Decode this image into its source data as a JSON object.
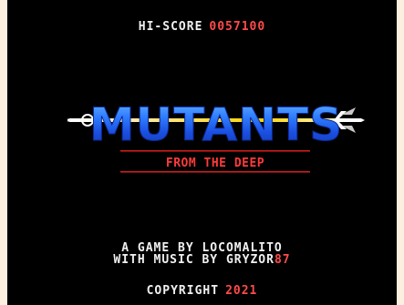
{
  "hud": {
    "hiscore_label": "HI-SCORE",
    "hiscore_value": "0057100"
  },
  "title": {
    "logo_main": "MUTANTS",
    "logo_sub": "FROM THE DEEP"
  },
  "credits": {
    "line1": "A GAME BY LOCOMALITO",
    "line2_prefix": "WITH MUSIC BY GRYZOR",
    "line2_suffix": "87",
    "copyright_label": "COPYRIGHT",
    "copyright_year": "2021"
  },
  "colors": {
    "background": "#000000",
    "frame": "#fcefe0",
    "text": "#f0f0f0",
    "accent_red": "#ff4a4a",
    "logo_blue": "#1f5cff",
    "logo_light_blue": "#4fa8ff",
    "logo_yellow": "#ffd400",
    "logo_red": "#d81e1e"
  }
}
